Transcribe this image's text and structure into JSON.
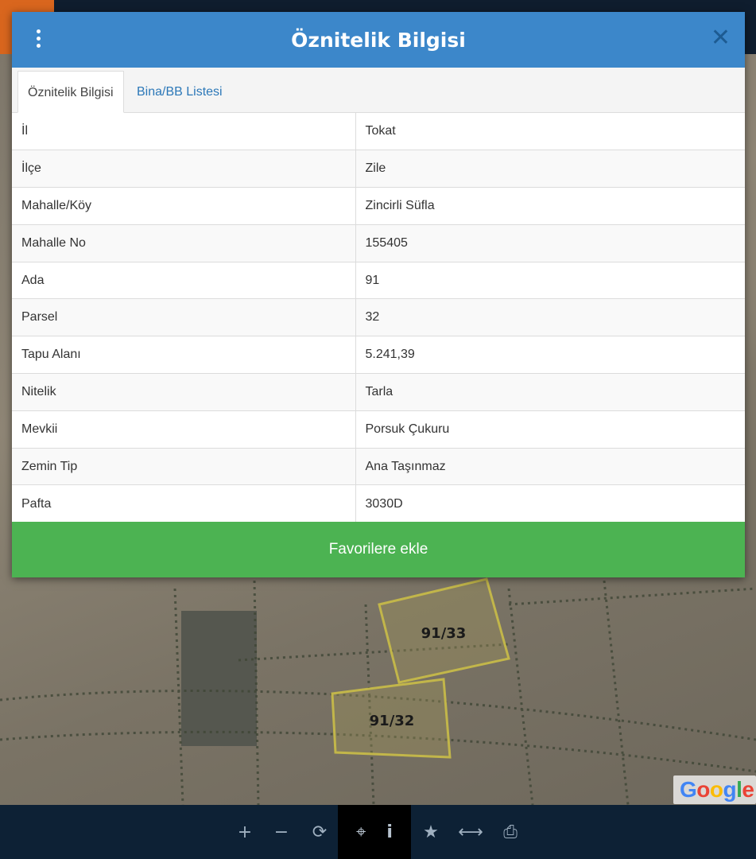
{
  "modal": {
    "title": "Öznitelik Bilgisi",
    "close_icon": "close-icon",
    "menu_icon": "kebab-menu-icon",
    "tabs": [
      {
        "label": "Öznitelik Bilgisi",
        "active": true
      },
      {
        "label": "Bina/BB Listesi",
        "active": false
      }
    ],
    "rows": [
      {
        "label": "İl",
        "value": "Tokat"
      },
      {
        "label": "İlçe",
        "value": "Zile"
      },
      {
        "label": "Mahalle/Köy",
        "value": "Zincirli Süfla"
      },
      {
        "label": "Mahalle No",
        "value": "155405"
      },
      {
        "label": "Ada",
        "value": "91"
      },
      {
        "label": "Parsel",
        "value": "32"
      },
      {
        "label": "Tapu Alanı",
        "value": "5.241,39"
      },
      {
        "label": "Nitelik",
        "value": "Tarla"
      },
      {
        "label": "Mevkii",
        "value": "Porsuk Çukuru"
      },
      {
        "label": "Zemin Tip",
        "value": "Ana Taşınmaz"
      },
      {
        "label": "Pafta",
        "value": "3030D"
      }
    ],
    "favorite_button": "Favorilere ekle"
  },
  "map": {
    "parcel_labels": [
      "91/33",
      "91/32"
    ],
    "google_logo": "Google"
  },
  "toolbar": {
    "buttons": [
      {
        "name": "zoom-in",
        "glyph": "+"
      },
      {
        "name": "zoom-out",
        "glyph": "−"
      },
      {
        "name": "refresh",
        "glyph": "⟳"
      },
      {
        "name": "locate",
        "glyph": "⌖"
      },
      {
        "name": "info",
        "glyph": "i"
      },
      {
        "name": "favorite",
        "glyph": "★"
      },
      {
        "name": "measure",
        "glyph": "⟷"
      },
      {
        "name": "print",
        "glyph": "⎙"
      }
    ]
  },
  "colors": {
    "header": "#3c87ca",
    "favorite_button": "#4cb352",
    "toolbar": "#0d2135"
  }
}
